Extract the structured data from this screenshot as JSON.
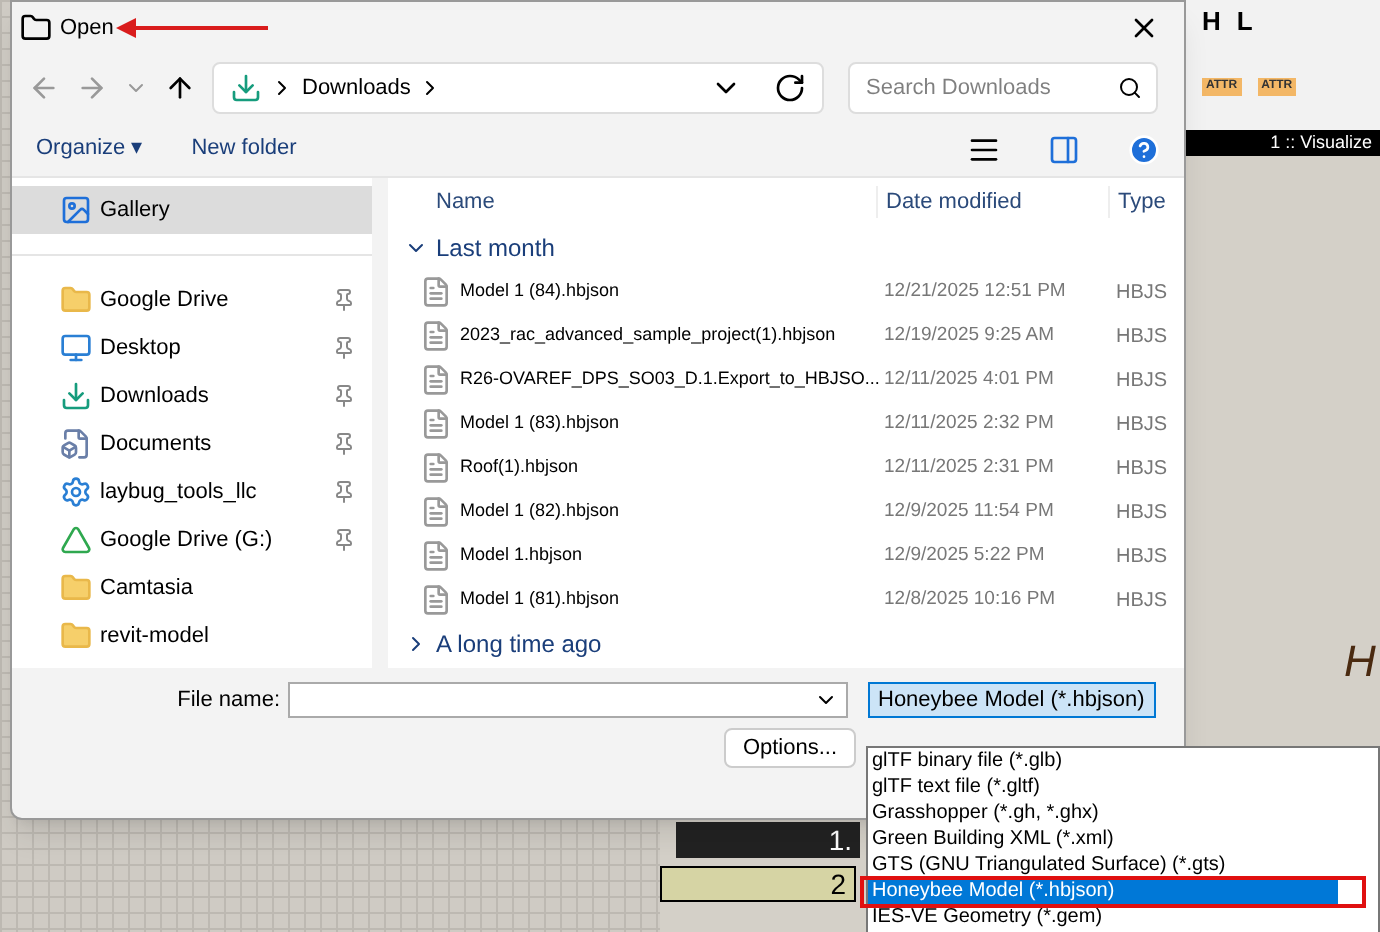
{
  "window": {
    "title": "Open"
  },
  "nav": {
    "path": "Downloads",
    "search": {
      "placeholder": "Search Downloads"
    }
  },
  "commands": {
    "organize": "Organize",
    "organize_caret": "▾",
    "new_folder": "New folder"
  },
  "sidebar": {
    "items": [
      {
        "label": "Gallery",
        "selected": true,
        "pinned": false
      },
      {
        "label": "Google Drive",
        "selected": false,
        "pinned": true
      },
      {
        "label": "Desktop",
        "selected": false,
        "pinned": true
      },
      {
        "label": "Downloads",
        "selected": false,
        "pinned": true
      },
      {
        "label": "Documents",
        "selected": false,
        "pinned": true
      },
      {
        "label": "laybug_tools_llc",
        "selected": false,
        "pinned": true
      },
      {
        "label": "Google Drive (G:)",
        "selected": false,
        "pinned": true
      },
      {
        "label": "Camtasia",
        "selected": false,
        "pinned": false
      },
      {
        "label": "revit-model",
        "selected": false,
        "pinned": false
      }
    ]
  },
  "table": {
    "columns": [
      "Name",
      "Date modified",
      "Type"
    ],
    "groups": [
      {
        "label": "Last month",
        "expanded": true,
        "rows": [
          {
            "name": "Model 1 (84).hbjson",
            "date": "12/21/2025 12:51 PM",
            "type": "HBJS"
          },
          {
            "name": "2023_rac_advanced_sample_project(1).hbjson",
            "date": "12/19/2025 9:25 AM",
            "type": "HBJS"
          },
          {
            "name": "R26-OVAREF_DPS_SO03_D.1.Export_to_HBJSO...",
            "date": "12/11/2025 4:01 PM",
            "type": "HBJS"
          },
          {
            "name": "Model 1 (83).hbjson",
            "date": "12/11/2025 2:32 PM",
            "type": "HBJS"
          },
          {
            "name": "Roof(1).hbjson",
            "date": "12/11/2025 2:31 PM",
            "type": "HBJS"
          },
          {
            "name": "Model 1 (82).hbjson",
            "date": "12/9/2025 11:54 PM",
            "type": "HBJS"
          },
          {
            "name": "Model 1.hbjson",
            "date": "12/9/2025 5:22 PM",
            "type": "HBJS"
          },
          {
            "name": "Model 1 (81).hbjson",
            "date": "12/8/2025 10:16 PM",
            "type": "HBJS"
          }
        ]
      },
      {
        "label": "A long time ago",
        "expanded": false
      }
    ]
  },
  "footer": {
    "file_name_label": "File name:",
    "file_type": "Honeybee Model (*.hbjson)",
    "options": "Options..."
  },
  "file_type_options": [
    {
      "label": "glTF binary file (*.glb)",
      "selected": false
    },
    {
      "label": "glTF text file (*.gltf)",
      "selected": false
    },
    {
      "label": "Grasshopper (*.gh, *.ghx)",
      "selected": false
    },
    {
      "label": "Green Building XML (*.xml)",
      "selected": false
    },
    {
      "label": "GTS (GNU Triangulated Surface) (*.gts)",
      "selected": false
    },
    {
      "label": "Honeybee Model (*.hbjson)",
      "selected": true
    },
    {
      "label": "IES-VE Geometry (*.gem)",
      "selected": false
    }
  ],
  "background": {
    "toolbar_letters": [
      "H",
      "L"
    ],
    "attr_labels": [
      "ATTR",
      "ATTR"
    ],
    "panel_label": "1 :: Visualize",
    "node_texts": [
      "1.",
      "2",
      "H"
    ]
  }
}
